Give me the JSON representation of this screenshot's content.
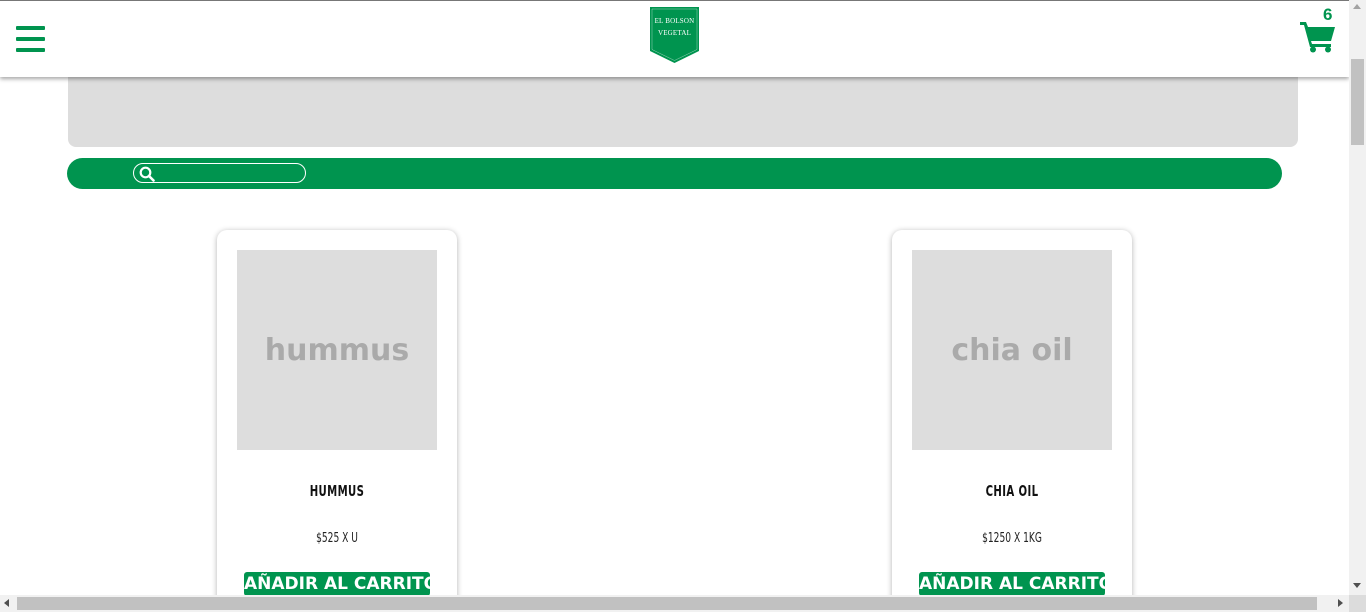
{
  "header": {
    "logo_line1": "EL BOLSON",
    "logo_line2": "VEGETAL",
    "cart_count": "6"
  },
  "search": {
    "placeholder": "",
    "value": ""
  },
  "products": [
    {
      "image_label": "hummus",
      "name": "HUMMUS",
      "price": "$525 X U",
      "button_label": "AÑADIR AL CARRITO"
    },
    {
      "image_label": "chia oil",
      "name": "CHIA OIL",
      "price": "$1250 X 1KG",
      "button_label": "AÑADIR AL CARRITO"
    }
  ],
  "colors": {
    "brand_green": "#00944f",
    "placeholder_gray": "#dddddd"
  },
  "icons": [
    "hamburger-menu-icon",
    "cart-icon",
    "search-icon",
    "logo-badge"
  ]
}
